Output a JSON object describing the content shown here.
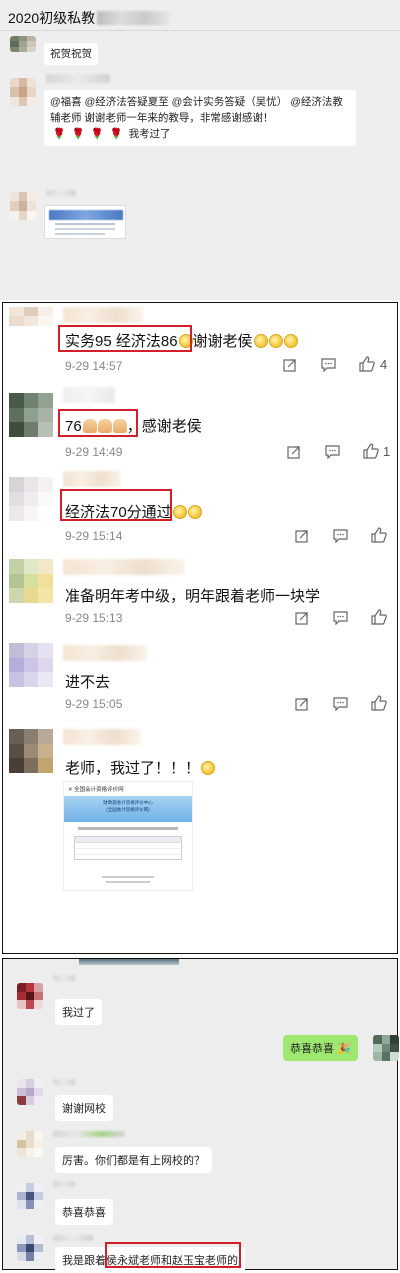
{
  "chat_group": {
    "title": "2020初级私教",
    "msg1": "祝贺祝贺",
    "msg2": "@福喜 @经济法答疑夏至 @会计实务答疑（吴忧） @经济法教辅老师 谢谢老师一年来的教导，非常感谢感谢！",
    "msg2_end": "我考过了"
  },
  "comments": [
    {
      "text": "实务95 经济法86",
      "suffix": "谢谢老侯",
      "time": "9-29 14:57",
      "likes": "4"
    },
    {
      "text": "76",
      "suffix": "，感谢老侯",
      "time": "9-29 14:49",
      "likes": "1"
    },
    {
      "text": "经济法70分通过",
      "suffix": "",
      "time": "9-29 15:14",
      "likes": ""
    },
    {
      "text": "准备明年考中级，明年跟着老师一块学",
      "suffix": "",
      "time": "9-29 15:13",
      "likes": ""
    },
    {
      "text": "进不去",
      "suffix": "",
      "time": "9-29 15:05",
      "likes": ""
    },
    {
      "text": "老师，我过了！！！",
      "suffix": "",
      "time": "",
      "likes": ""
    }
  ],
  "result_image": {
    "nav_title": "全国会计资格评价网",
    "banner_line1": "财政部会计资格评价中心",
    "banner_line2": "(全国会计资格评价网)"
  },
  "chat": {
    "m1": "我过了",
    "m2": "恭喜恭喜",
    "m3": "谢谢网校",
    "m4": "厉害。你们都是有上网校的？",
    "m5": "恭喜恭喜",
    "m6_prefix": "我是跟着",
    "m6_hl": "侯永斌老师和赵玉宝老师的"
  },
  "colors": {
    "highlight": "#d0202a",
    "green_bubble": "#9fe870"
  }
}
